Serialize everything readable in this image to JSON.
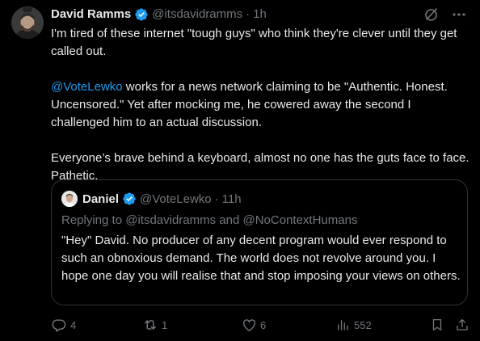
{
  "colors": {
    "background": "#000000",
    "text_primary": "#e7e9ea",
    "text_secondary": "#71767b",
    "accent": "#1d9bf0",
    "border": "#2f3336"
  },
  "tweet": {
    "author_name": "David Ramms",
    "author_handle": "@itsdavidramms",
    "separator": "·",
    "time": "1h",
    "paragraph_1": "I'm tired of these internet \"tough guys\" who think they're clever until they get called out.",
    "paragraph_2_mention": "@VoteLewko",
    "paragraph_2_rest": " works for a news network claiming to be \"Authentic. Honest. Uncensored.\" Yet after mocking me, he cowered away the second I challenged him to an actual discussion.",
    "paragraph_3": "Everyone’s brave behind a keyboard, almost no one has the guts face to face. Pathetic.",
    "top_icons": [
      "grok-icon",
      "more-icon"
    ],
    "more_label": "···"
  },
  "quote": {
    "author_name": "Daniel",
    "author_handle": "@VoteLewko",
    "separator": "·",
    "time": "11h",
    "replying_to": "Replying to @itsdavidramms and @NoContextHumans",
    "text": "\"Hey\" David. No producer of any decent program would ever respond to such an obnoxious demand. The world does not revolve around you. I hope one day you will realise that and stop imposing your views on others."
  },
  "actions": {
    "replies": "4",
    "reposts": "1",
    "likes": "6",
    "views": "552",
    "icons": [
      "reply-icon",
      "repost-icon",
      "like-icon",
      "views-icon",
      "bookmark-icon",
      "share-icon"
    ]
  }
}
